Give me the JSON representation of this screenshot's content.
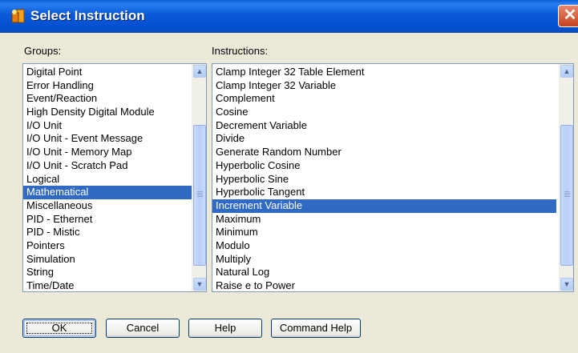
{
  "window": {
    "title": "Select Instruction",
    "close_label": "✕"
  },
  "groups": {
    "label": "Groups:",
    "items": [
      "Digital Point",
      "Error Handling",
      "Event/Reaction",
      "High Density Digital Module",
      "I/O Unit",
      "I/O Unit - Event Message",
      "I/O Unit - Memory Map",
      "I/O Unit - Scratch Pad",
      "Logical",
      "Mathematical",
      "Miscellaneous",
      "PID - Ethernet",
      "PID - Mistic",
      "Pointers",
      "Simulation",
      "String",
      "Time/Date"
    ],
    "selected": "Mathematical"
  },
  "instructions": {
    "label": "Instructions:",
    "items": [
      "Clamp Integer 32 Table Element",
      "Clamp Integer 32 Variable",
      "Complement",
      "Cosine",
      "Decrement Variable",
      "Divide",
      "Generate Random Number",
      "Hyperbolic Cosine",
      "Hyperbolic Sine",
      "Hyperbolic Tangent",
      "Increment Variable",
      "Maximum",
      "Minimum",
      "Modulo",
      "Multiply",
      "Natural Log",
      "Raise e to Power"
    ],
    "selected": "Increment Variable"
  },
  "buttons": {
    "ok": "OK",
    "cancel": "Cancel",
    "help": "Help",
    "command_help": "Command Help"
  }
}
